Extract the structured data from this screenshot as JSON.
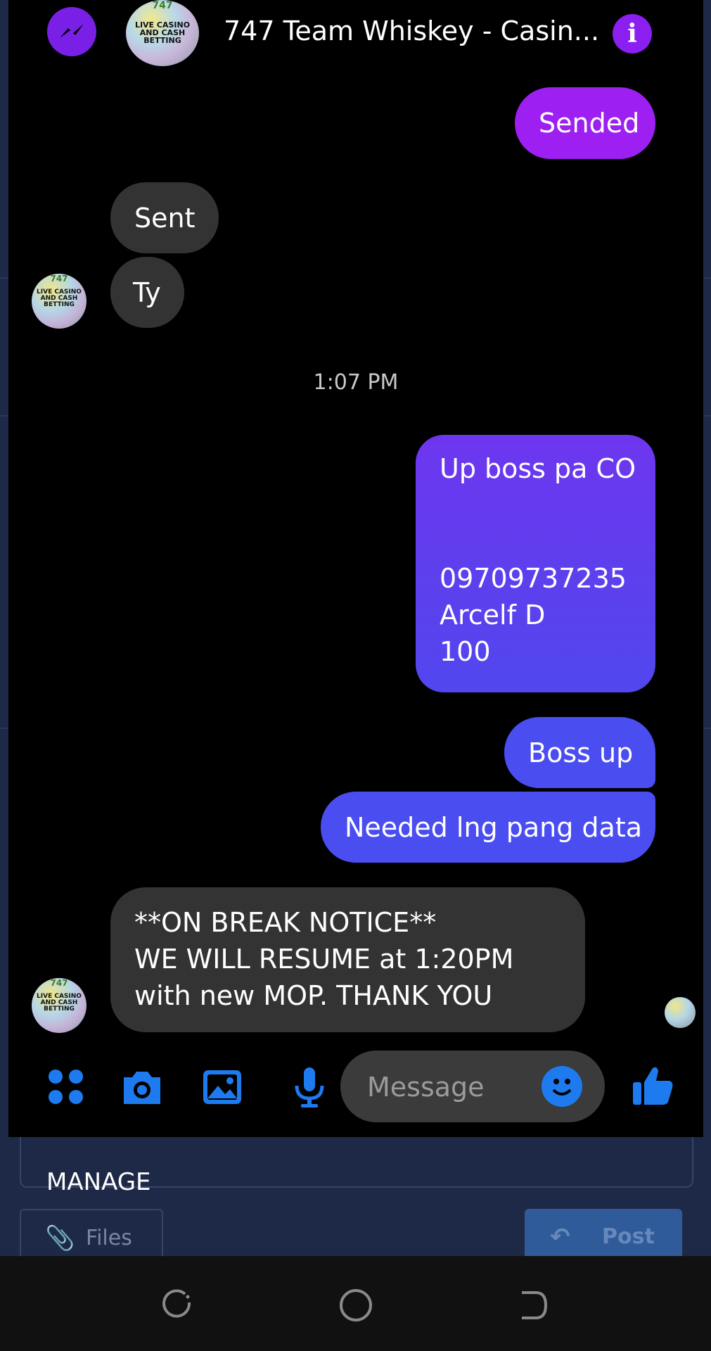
{
  "header": {
    "title": "747 Team Whiskey - Casin...",
    "avatar_text_top": "747",
    "avatar_text_mid": "LIVE CASINO AND CASH BETTING"
  },
  "messages": [
    {
      "side": "me",
      "text": "Sended"
    },
    {
      "side": "them",
      "text": "Sent"
    },
    {
      "side": "them",
      "text": "Ty"
    },
    {
      "side": "me",
      "text": "Up boss pa CO\n\n\n09709737235\nArcelf D\n100"
    },
    {
      "side": "me",
      "text": "Boss up"
    },
    {
      "side": "me",
      "text": "Needed lng pang data"
    },
    {
      "side": "them",
      "text": "**ON BREAK NOTICE**\nWE WILL RESUME at 1:20PM with new MOP. THANK YOU"
    }
  ],
  "timestamp": "1:07 PM",
  "composer": {
    "placeholder": "Message",
    "icons": [
      "menu-dots-icon",
      "camera-icon",
      "gallery-icon",
      "microphone-icon",
      "emoji-icon",
      "thumbs-up-icon"
    ]
  },
  "background_app": {
    "manage_label": "MANAGE",
    "files_label": "Files",
    "post_label": "Post"
  },
  "colors": {
    "messenger_purple": "#9d1ff2",
    "bubble_violet": "#6d36ef",
    "bubble_blue": "#4a4df0",
    "bubble_them": "#333333",
    "composer_blue": "#1d7bef"
  }
}
